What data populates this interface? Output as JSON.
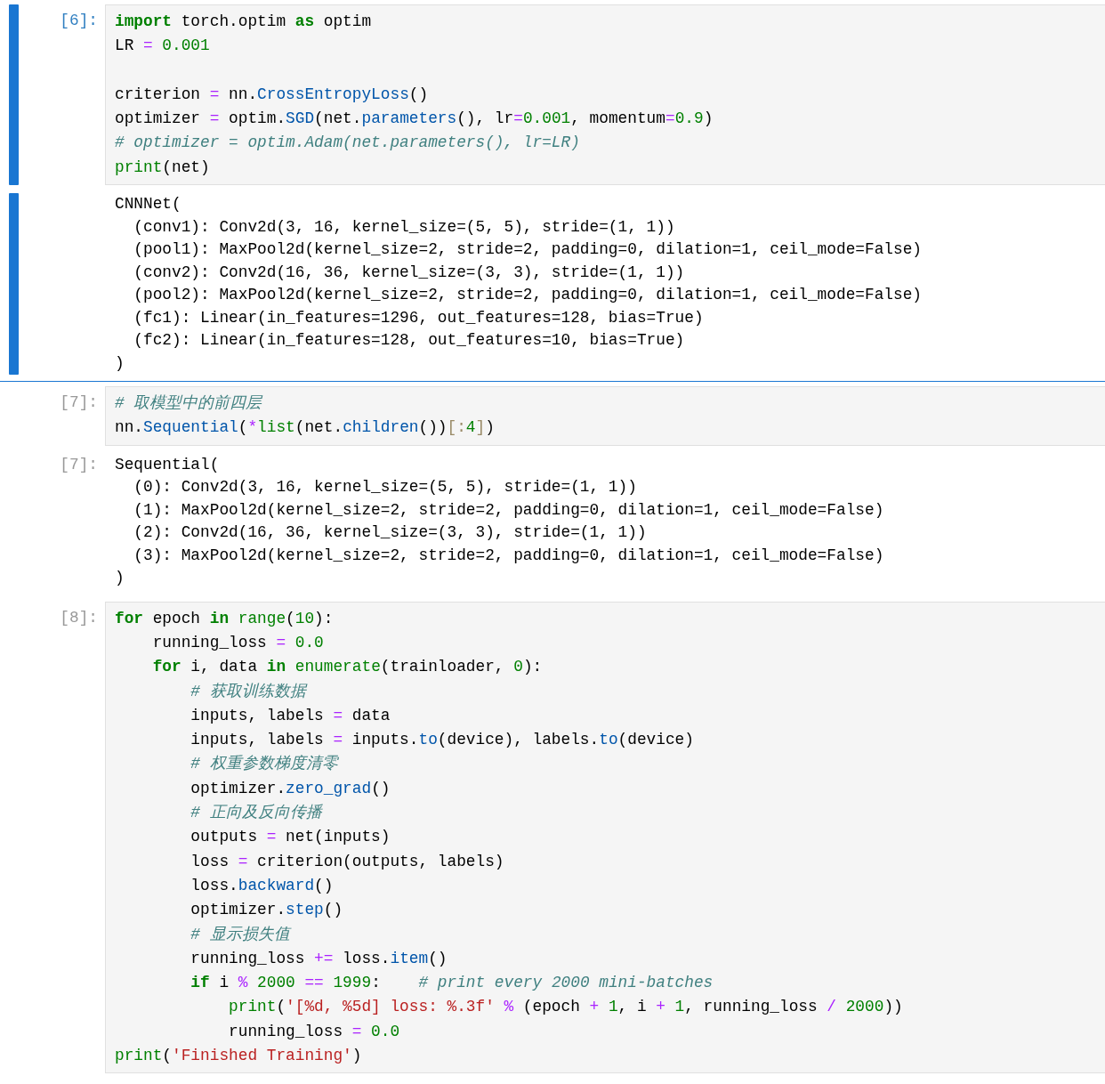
{
  "cells": [
    {
      "selected": true,
      "prompt": "[6]:",
      "input": [
        {
          "kind": "code",
          "tokens": [
            {
              "kind": "kw",
              "text": "import"
            },
            {
              "kind": "text",
              "text": " torch.optim "
            },
            {
              "kind": "kw",
              "text": "as"
            },
            {
              "kind": "text",
              "text": " optim"
            }
          ]
        },
        {
          "kind": "code",
          "tokens": [
            {
              "kind": "text",
              "text": "LR "
            },
            {
              "kind": "op",
              "text": "="
            },
            {
              "kind": "num",
              "text": " 0.001"
            }
          ]
        },
        {
          "kind": "blank"
        },
        {
          "kind": "code",
          "tokens": [
            {
              "kind": "text",
              "text": "criterion "
            },
            {
              "kind": "op",
              "text": "="
            },
            {
              "kind": "text",
              "text": " nn."
            },
            {
              "kind": "call",
              "text": "CrossEntropyLoss"
            },
            {
              "kind": "text",
              "text": "()"
            }
          ]
        },
        {
          "kind": "code",
          "tokens": [
            {
              "kind": "text",
              "text": "optimizer "
            },
            {
              "kind": "op",
              "text": "="
            },
            {
              "kind": "text",
              "text": " optim."
            },
            {
              "kind": "call",
              "text": "SGD"
            },
            {
              "kind": "text",
              "text": "(net."
            },
            {
              "kind": "call",
              "text": "parameters"
            },
            {
              "kind": "text",
              "text": "(), lr"
            },
            {
              "kind": "op",
              "text": "="
            },
            {
              "kind": "num",
              "text": "0.001"
            },
            {
              "kind": "text",
              "text": ", momentum"
            },
            {
              "kind": "op",
              "text": "="
            },
            {
              "kind": "num",
              "text": "0.9"
            },
            {
              "kind": "text",
              "text": ")"
            }
          ]
        },
        {
          "kind": "code",
          "tokens": [
            {
              "kind": "comment",
              "text": "# optimizer = optim.Adam(net.parameters(), lr=LR)"
            }
          ]
        },
        {
          "kind": "code",
          "tokens": [
            {
              "kind": "builtin",
              "text": "print"
            },
            {
              "kind": "text",
              "text": "(net)"
            }
          ]
        }
      ],
      "output": {
        "lines": [
          "CNNNet(",
          "  (conv1): Conv2d(3, 16, kernel_size=(5, 5), stride=(1, 1))",
          "  (pool1): MaxPool2d(kernel_size=2, stride=2, padding=0, dilation=1, ceil_mode=False)",
          "  (conv2): Conv2d(16, 36, kernel_size=(3, 3), stride=(1, 1))",
          "  (pool2): MaxPool2d(kernel_size=2, stride=2, padding=0, dilation=1, ceil_mode=False)",
          "  (fc1): Linear(in_features=1296, out_features=128, bias=True)",
          "  (fc2): Linear(in_features=128, out_features=10, bias=True)",
          ")"
        ]
      }
    },
    {
      "selected": false,
      "prompt": "[7]:",
      "input": [
        {
          "kind": "code",
          "tokens": [
            {
              "kind": "comment",
              "text": "# 取模型中的前四层"
            }
          ]
        },
        {
          "kind": "code",
          "tokens": [
            {
              "kind": "text",
              "text": "nn."
            },
            {
              "kind": "call",
              "text": "Sequential"
            },
            {
              "kind": "text",
              "text": "("
            },
            {
              "kind": "op",
              "text": "*"
            },
            {
              "kind": "builtin",
              "text": "list"
            },
            {
              "kind": "text",
              "text": "(net."
            },
            {
              "kind": "call",
              "text": "children"
            },
            {
              "kind": "text",
              "text": "())"
            },
            {
              "kind": "dim",
              "text": "[:"
            },
            {
              "kind": "num",
              "text": "4"
            },
            {
              "kind": "dim",
              "text": "]"
            },
            {
              "kind": "text",
              "text": ")"
            }
          ]
        }
      ],
      "output": {
        "prompt": "[7]:",
        "lines": [
          "Sequential(",
          "  (0): Conv2d(3, 16, kernel_size=(5, 5), stride=(1, 1))",
          "  (1): MaxPool2d(kernel_size=2, stride=2, padding=0, dilation=1, ceil_mode=False)",
          "  (2): Conv2d(16, 36, kernel_size=(3, 3), stride=(1, 1))",
          "  (3): MaxPool2d(kernel_size=2, stride=2, padding=0, dilation=1, ceil_mode=False)",
          ")"
        ]
      }
    },
    {
      "selected": false,
      "prompt": "[8]:",
      "input": [
        {
          "kind": "code",
          "tokens": [
            {
              "kind": "kw",
              "text": "for"
            },
            {
              "kind": "text",
              "text": " epoch "
            },
            {
              "kind": "kw",
              "text": "in"
            },
            {
              "kind": "builtin",
              "text": " range"
            },
            {
              "kind": "text",
              "text": "("
            },
            {
              "kind": "num",
              "text": "10"
            },
            {
              "kind": "text",
              "text": "):"
            }
          ]
        },
        {
          "kind": "code",
          "tokens": [
            {
              "kind": "text",
              "text": "    running_loss "
            },
            {
              "kind": "op",
              "text": "="
            },
            {
              "kind": "num",
              "text": " 0.0"
            }
          ]
        },
        {
          "kind": "code",
          "tokens": [
            {
              "kind": "kw",
              "text": "    for"
            },
            {
              "kind": "text",
              "text": " i, data "
            },
            {
              "kind": "kw",
              "text": "in"
            },
            {
              "kind": "builtin",
              "text": " enumerate"
            },
            {
              "kind": "text",
              "text": "(trainloader, "
            },
            {
              "kind": "num",
              "text": "0"
            },
            {
              "kind": "text",
              "text": "):"
            }
          ]
        },
        {
          "kind": "code",
          "tokens": [
            {
              "kind": "comment",
              "text": "        # 获取训练数据"
            }
          ]
        },
        {
          "kind": "code",
          "tokens": [
            {
              "kind": "text",
              "text": "        inputs, labels "
            },
            {
              "kind": "op",
              "text": "="
            },
            {
              "kind": "text",
              "text": " data"
            }
          ]
        },
        {
          "kind": "code",
          "tokens": [
            {
              "kind": "text",
              "text": "        inputs, labels "
            },
            {
              "kind": "op",
              "text": "="
            },
            {
              "kind": "text",
              "text": " inputs."
            },
            {
              "kind": "call",
              "text": "to"
            },
            {
              "kind": "text",
              "text": "(device), labels."
            },
            {
              "kind": "call",
              "text": "to"
            },
            {
              "kind": "text",
              "text": "(device)"
            }
          ]
        },
        {
          "kind": "code",
          "tokens": [
            {
              "kind": "comment",
              "text": "        # 权重参数梯度清零"
            }
          ]
        },
        {
          "kind": "code",
          "tokens": [
            {
              "kind": "text",
              "text": "        optimizer."
            },
            {
              "kind": "call",
              "text": "zero_grad"
            },
            {
              "kind": "text",
              "text": "()"
            }
          ]
        },
        {
          "kind": "code",
          "tokens": [
            {
              "kind": "comment",
              "text": "        # 正向及反向传播"
            }
          ]
        },
        {
          "kind": "code",
          "tokens": [
            {
              "kind": "text",
              "text": "        outputs "
            },
            {
              "kind": "op",
              "text": "="
            },
            {
              "kind": "text",
              "text": " net(inputs)"
            }
          ]
        },
        {
          "kind": "code",
          "tokens": [
            {
              "kind": "text",
              "text": "        loss "
            },
            {
              "kind": "op",
              "text": "="
            },
            {
              "kind": "text",
              "text": " criterion(outputs, labels)"
            }
          ]
        },
        {
          "kind": "code",
          "tokens": [
            {
              "kind": "text",
              "text": "        loss."
            },
            {
              "kind": "call",
              "text": "backward"
            },
            {
              "kind": "text",
              "text": "()"
            }
          ]
        },
        {
          "kind": "code",
          "tokens": [
            {
              "kind": "text",
              "text": "        optimizer."
            },
            {
              "kind": "call",
              "text": "step"
            },
            {
              "kind": "text",
              "text": "()"
            }
          ]
        },
        {
          "kind": "code",
          "tokens": [
            {
              "kind": "comment",
              "text": "        # 显示损失值"
            }
          ]
        },
        {
          "kind": "code",
          "tokens": [
            {
              "kind": "text",
              "text": "        running_loss "
            },
            {
              "kind": "op",
              "text": "+="
            },
            {
              "kind": "text",
              "text": " loss."
            },
            {
              "kind": "call",
              "text": "item"
            },
            {
              "kind": "text",
              "text": "()"
            }
          ]
        },
        {
          "kind": "code",
          "tokens": [
            {
              "kind": "kw",
              "text": "        if"
            },
            {
              "kind": "text",
              "text": " i "
            },
            {
              "kind": "op",
              "text": "%"
            },
            {
              "kind": "num",
              "text": " 2000 "
            },
            {
              "kind": "op",
              "text": "=="
            },
            {
              "kind": "num",
              "text": " 1999"
            },
            {
              "kind": "text",
              "text": ":"
            },
            {
              "kind": "comment",
              "text": "    # print every 2000 mini-batches"
            }
          ]
        },
        {
          "kind": "code",
          "tokens": [
            {
              "kind": "builtin",
              "text": "            print"
            },
            {
              "kind": "text",
              "text": "("
            },
            {
              "kind": "string",
              "text": "'[%d, %5d] loss: %.3f'"
            },
            {
              "kind": "op",
              "text": " %"
            },
            {
              "kind": "text",
              "text": " (epoch "
            },
            {
              "kind": "op",
              "text": "+"
            },
            {
              "kind": "num",
              "text": " 1"
            },
            {
              "kind": "text",
              "text": ", i "
            },
            {
              "kind": "op",
              "text": "+"
            },
            {
              "kind": "num",
              "text": " 1"
            },
            {
              "kind": "text",
              "text": ", running_loss "
            },
            {
              "kind": "op",
              "text": "/"
            },
            {
              "kind": "num",
              "text": " 2000"
            },
            {
              "kind": "text",
              "text": "))"
            }
          ]
        },
        {
          "kind": "code",
          "tokens": [
            {
              "kind": "text",
              "text": "            running_loss "
            },
            {
              "kind": "op",
              "text": "="
            },
            {
              "kind": "num",
              "text": " 0.0"
            }
          ]
        },
        {
          "kind": "code",
          "tokens": [
            {
              "kind": "builtin",
              "text": "print"
            },
            {
              "kind": "text",
              "text": "("
            },
            {
              "kind": "string",
              "text": "'Finished Training'"
            },
            {
              "kind": "text",
              "text": ")"
            }
          ]
        }
      ]
    }
  ]
}
